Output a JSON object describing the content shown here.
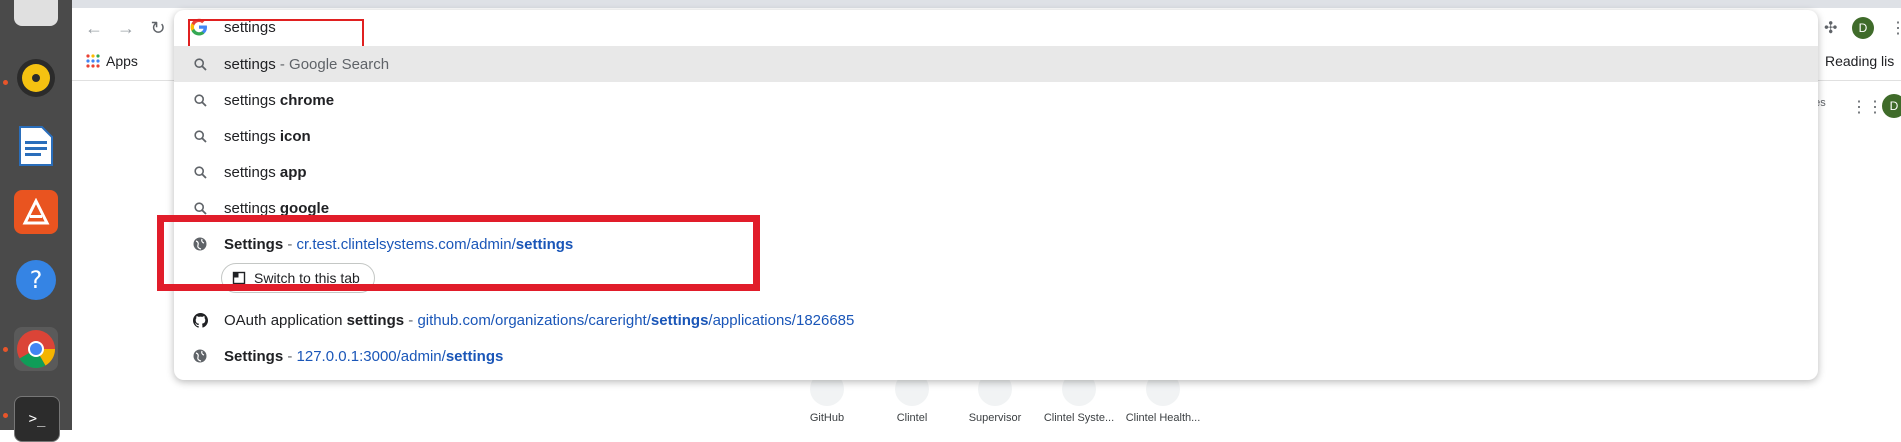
{
  "omnibox": {
    "query": "settings",
    "suggestions": [
      {
        "icon": "search-icon",
        "prefix": "settings",
        "bold": "",
        "suffix": " - Google Search",
        "url_plain": "",
        "url_bold": "",
        "url_tail": ""
      },
      {
        "icon": "search-icon",
        "prefix": "settings ",
        "bold": "chrome",
        "suffix": "",
        "url_plain": "",
        "url_bold": "",
        "url_tail": ""
      },
      {
        "icon": "search-icon",
        "prefix": "settings ",
        "bold": "icon",
        "suffix": "",
        "url_plain": "",
        "url_bold": "",
        "url_tail": ""
      },
      {
        "icon": "search-icon",
        "prefix": "settings ",
        "bold": "app",
        "suffix": "",
        "url_plain": "",
        "url_bold": "",
        "url_tail": ""
      },
      {
        "icon": "search-icon",
        "prefix": "settings ",
        "bold": "google",
        "suffix": "",
        "url_plain": "",
        "url_bold": "",
        "url_tail": ""
      },
      {
        "icon": "globe-icon",
        "prefix": "",
        "bold": "Settings",
        "suffix": " - ",
        "url_plain": "cr.test.clintelsystems.com/admin/",
        "url_bold": "settings",
        "url_tail": ""
      },
      {
        "icon": "github-icon",
        "prefix": "OAuth application ",
        "bold": "settings",
        "suffix": " - ",
        "url_plain": "github.com/organizations/careright/",
        "url_bold": "settings",
        "url_tail": "/applications/1826685"
      },
      {
        "icon": "globe-icon",
        "prefix": "",
        "bold": "Settings",
        "suffix": " - ",
        "url_plain": "127.0.0.1:3000/admin/",
        "url_bold": "settings",
        "url_tail": ""
      }
    ],
    "switch_tab_label": "Switch to this tab"
  },
  "bookmarks": {
    "apps_label": "Apps",
    "reading_list": "Reading lis"
  },
  "page": {
    "partial_text": "ges"
  },
  "profile": {
    "initial": "D"
  },
  "shortcuts": [
    {
      "label": "GitHub"
    },
    {
      "label": "Clintel"
    },
    {
      "label": "Supervisor"
    },
    {
      "label": "Clintel Syste..."
    },
    {
      "label": "Clintel Health..."
    }
  ],
  "colors": {
    "highlight": "#e11d2a",
    "url": "#1a56b8",
    "selected_row": "#e8e8e8"
  }
}
